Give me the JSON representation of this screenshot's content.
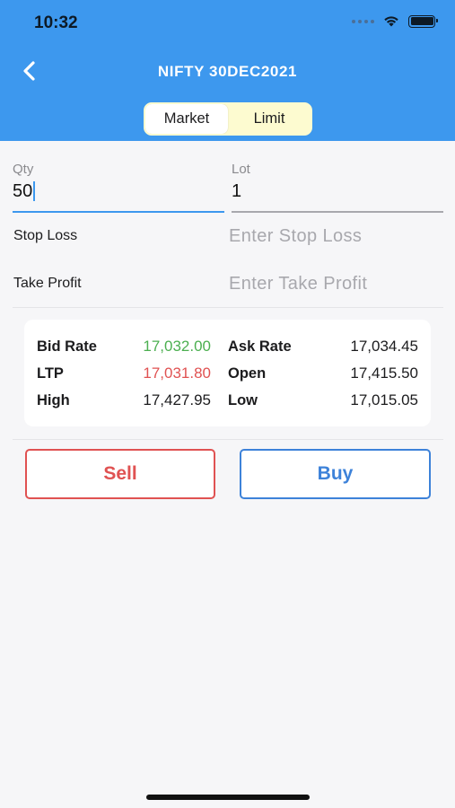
{
  "status_bar": {
    "time": "10:32"
  },
  "nav": {
    "title": "NIFTY 30DEC2021",
    "back_icon": "chevron-left-icon"
  },
  "order_type_tabs": [
    {
      "label": "Market",
      "selected": true
    },
    {
      "label": "Limit",
      "selected": false
    }
  ],
  "form": {
    "qty": {
      "label": "Qty",
      "value": "50"
    },
    "lot": {
      "label": "Lot",
      "value": "1"
    },
    "stop_loss": {
      "label": "Stop Loss",
      "placeholder": "Enter Stop Loss"
    },
    "take_profit": {
      "label": "Take Profit",
      "placeholder": "Enter Take Profit"
    }
  },
  "quote": {
    "bid_rate": {
      "label": "Bid Rate",
      "value": "17,032.00"
    },
    "ask_rate": {
      "label": "Ask Rate",
      "value": "17,034.45"
    },
    "ltp": {
      "label": "LTP",
      "value": "17,031.80"
    },
    "open": {
      "label": "Open",
      "value": "17,415.50"
    },
    "high": {
      "label": "High",
      "value": "17,427.95"
    },
    "low": {
      "label": "Low",
      "value": "17,015.05"
    }
  },
  "actions": {
    "sell_label": "Sell",
    "buy_label": "Buy"
  },
  "colors": {
    "header_blue": "#3d98ee",
    "sell_red": "#e05252",
    "buy_blue": "#3d82d9",
    "bid_green": "#4caf50",
    "ltp_red": "#e05252",
    "limit_tab_bg": "#fdfbd0"
  }
}
